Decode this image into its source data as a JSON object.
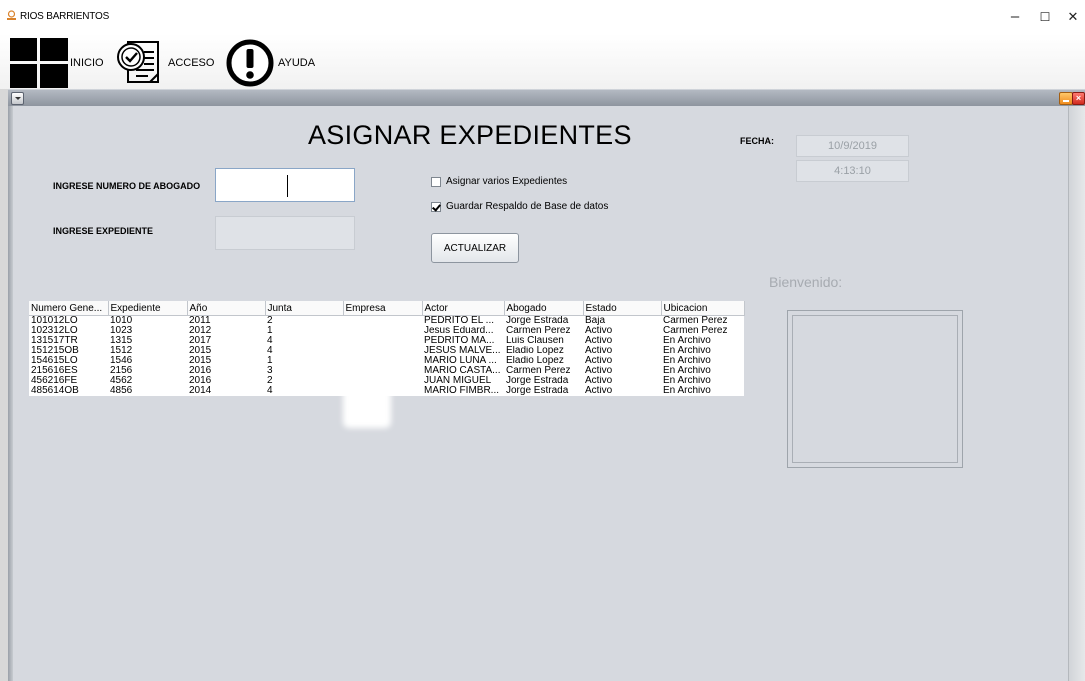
{
  "window": {
    "title": "RIOS BARRIENTOS",
    "minimize": "–",
    "maximize": "☐",
    "close": "✕"
  },
  "menu": [
    {
      "label": "INICIO",
      "icon": "windows-icon"
    },
    {
      "label": "ACCESO",
      "icon": "checklist-icon"
    },
    {
      "label": "AYUDA",
      "icon": "exclamation-icon"
    }
  ],
  "form": {
    "title": "ASIGNAR EXPEDIENTES",
    "lawyer_label": "INGRESE NUMERO DE ABOGADO",
    "lawyer_value": "",
    "file_label": "INGRESE EXPEDIENTE",
    "file_value": "",
    "checkbox_multiple": {
      "label": "Asignar varios Expedientes",
      "checked": false
    },
    "checkbox_backup": {
      "label": "Guardar Respaldo de Base de datos",
      "checked": true
    },
    "update_button": "ACTUALIZAR",
    "date_label": "FECHA:",
    "date_value": "10/9/2019",
    "time_value": "4:13:10",
    "welcome": "Bienvenido:"
  },
  "table": {
    "columns": [
      "Numero Gene...",
      "Expediente",
      "Año",
      "Junta",
      "Empresa",
      "Actor",
      "Abogado",
      "Estado",
      "Ubicacion"
    ],
    "rows": [
      [
        "101012LO",
        "1010",
        "2011",
        "2",
        "",
        "PEDRITO EL ...",
        "Jorge Estrada",
        "Baja",
        "Carmen Perez"
      ],
      [
        "102312LO",
        "1023",
        "2012",
        "1",
        "",
        "Jesus Eduard...",
        "Carmen Perez",
        "Activo",
        "Carmen Perez"
      ],
      [
        "131517TR",
        "1315",
        "2017",
        "4",
        "",
        "PEDRITO MA...",
        "Luis Clausen",
        "Activo",
        "En Archivo"
      ],
      [
        "151215OB",
        "1512",
        "2015",
        "4",
        "",
        "JESUS MALVE...",
        "Eladio Lopez",
        "Activo",
        "En Archivo"
      ],
      [
        "154615LO",
        "1546",
        "2015",
        "1",
        "",
        "MARIO LUNA ...",
        "Eladio Lopez",
        "Activo",
        "En Archivo"
      ],
      [
        "215616ES",
        "2156",
        "2016",
        "3",
        "",
        "MARIO CASTA...",
        "Carmen Perez",
        "Activo",
        "En Archivo"
      ],
      [
        "456216FE",
        "4562",
        "2016",
        "2",
        "",
        "JUAN MIGUEL",
        "Jorge Estrada",
        "Activo",
        "En Archivo"
      ],
      [
        "485614OB",
        "4856",
        "2014",
        "4",
        "",
        "MARIO FIMBR...",
        "Jorge Estrada",
        "Activo",
        "En Archivo"
      ]
    ]
  }
}
